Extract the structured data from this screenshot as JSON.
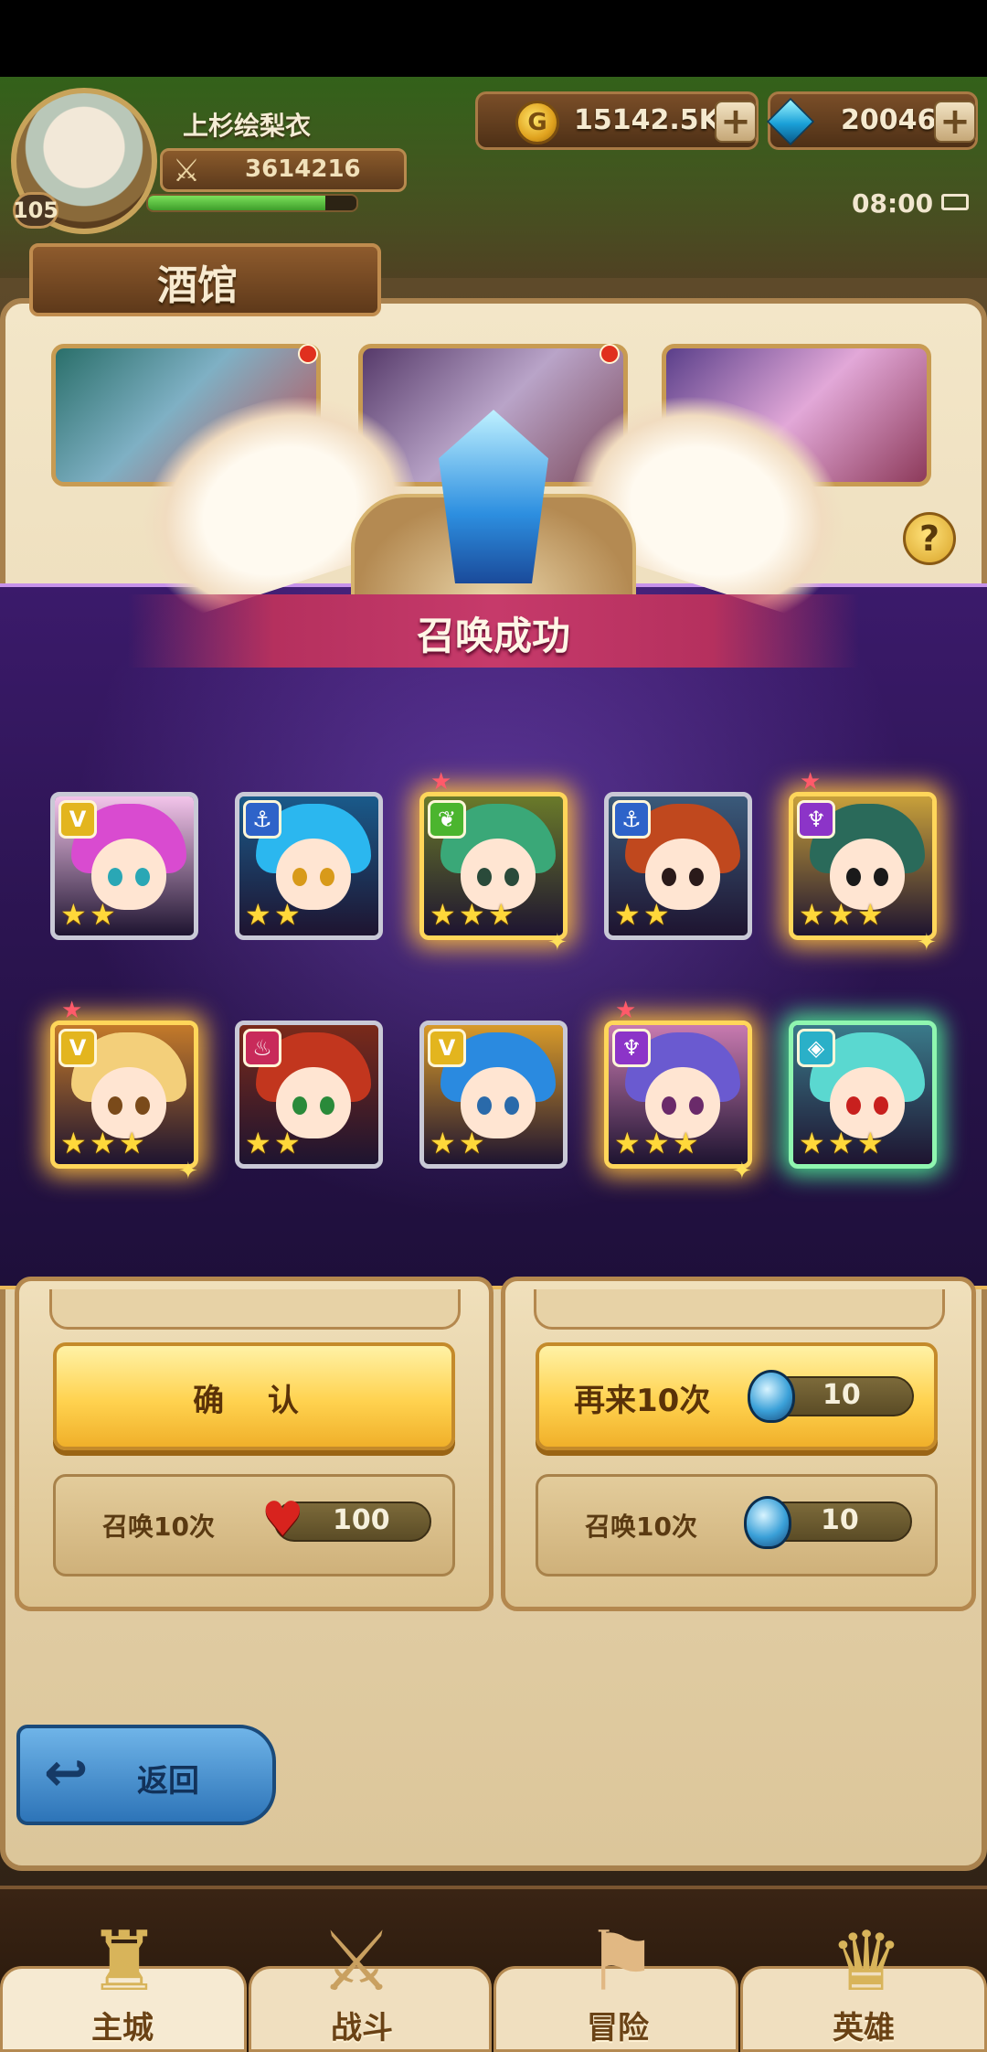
{
  "player": {
    "name": "上杉绘梨衣",
    "level": "105",
    "power": "3614216",
    "exp_fraction": 0.85
  },
  "resources": {
    "gold": "15142.5K",
    "gems": "20046"
  },
  "status": {
    "time": "08:00"
  },
  "page": {
    "title": "酒馆"
  },
  "summon_result": {
    "title": "召唤成功",
    "heroes": [
      {
        "faction_icon": "v-chevron-icon",
        "faction_color": "#e3b51e",
        "stars": 2,
        "rarity": "normal",
        "hair": "#d94bd0",
        "bg": "#f3c4ea",
        "eye": "#2aa7b5"
      },
      {
        "faction_icon": "anchor-icon",
        "faction_color": "#2e63c9",
        "stars": 2,
        "rarity": "normal",
        "hair": "#2bb7ef",
        "bg": "#1a5a8a",
        "eye": "#d89a1a"
      },
      {
        "faction_icon": "leaf-icon",
        "faction_color": "#4bb52e",
        "stars": 3,
        "rarity": "gold",
        "hair": "#3aa878",
        "bg": "#6a7a2a",
        "eye": "#2a4a3a"
      },
      {
        "faction_icon": "anchor-icon",
        "faction_color": "#2e63c9",
        "stars": 2,
        "rarity": "normal",
        "hair": "#c0481e",
        "bg": "#3a5a7a",
        "eye": "#2a1a1a"
      },
      {
        "faction_icon": "demon-icon",
        "faction_color": "#8c34c8",
        "stars": 3,
        "rarity": "gold",
        "hair": "#2a6a5a",
        "bg": "#c8a03a",
        "eye": "#1a1a1a"
      },
      {
        "faction_icon": "v-chevron-icon",
        "faction_color": "#e3b51e",
        "stars": 3,
        "rarity": "gold",
        "hair": "#f3cf7a",
        "bg": "#c47a2a",
        "eye": "#7a4a1a"
      },
      {
        "faction_icon": "flame-icon",
        "faction_color": "#c82a5a",
        "stars": 2,
        "rarity": "normal",
        "hair": "#c2361e",
        "bg": "#7a2a1a",
        "eye": "#2a8a3a"
      },
      {
        "faction_icon": "v-chevron-icon",
        "faction_color": "#e3b51e",
        "stars": 2,
        "rarity": "normal",
        "hair": "#2a8ae0",
        "bg": "#d89a2a",
        "eye": "#2a6aaa"
      },
      {
        "faction_icon": "demon-icon",
        "faction_color": "#8c34c8",
        "stars": 3,
        "rarity": "gold",
        "hair": "#6a5ad0",
        "bg": "#c87ab0",
        "eye": "#6a2a6a"
      },
      {
        "faction_icon": "diamond-icon",
        "faction_color": "#2ab0c8",
        "stars": 3,
        "rarity": "green",
        "hair": "#5ad8d0",
        "bg": "#3a7a8a",
        "eye": "#c8201e"
      }
    ]
  },
  "actions": {
    "confirm_label": "确 认",
    "again_label": "再来10次",
    "again_cost": "10"
  },
  "summon_options": {
    "left": {
      "label": "召唤10次",
      "cost": "100",
      "currency_icon": "heart-icon"
    },
    "right": {
      "label": "召唤10次",
      "cost": "10",
      "currency_icon": "egg-icon"
    }
  },
  "back": {
    "label": "返回"
  },
  "nav": [
    {
      "label": "主城",
      "icon": "castle-icon",
      "glyph": "♜"
    },
    {
      "label": "战斗",
      "icon": "crossed-swords-icon",
      "glyph": "⚔"
    },
    {
      "label": "冒险",
      "icon": "scroll-map-icon",
      "glyph": "⚑"
    },
    {
      "label": "英雄",
      "icon": "helmet-icon",
      "glyph": "♛"
    }
  ]
}
